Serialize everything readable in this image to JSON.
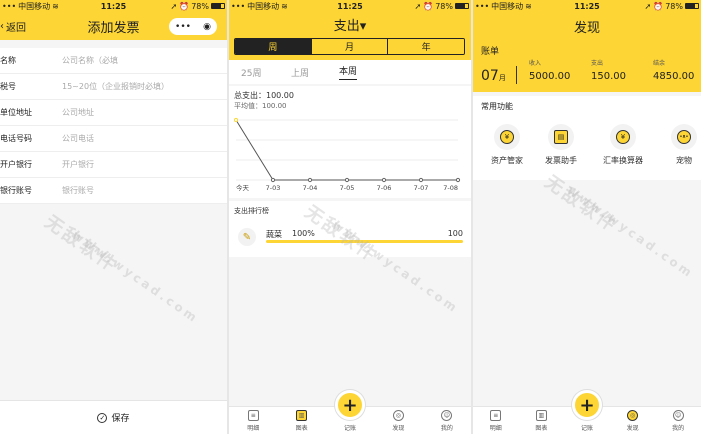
{
  "status": {
    "carrier": "中国移动",
    "time": "11:25",
    "battery": "78%",
    "battery_level": 0.78
  },
  "screen1": {
    "back_label": "返回",
    "title": "添加发票",
    "capsule_more": "•••",
    "capsule_close": "◉",
    "fields": [
      {
        "label": "名称",
        "placeholder": "公司名称（必填"
      },
      {
        "label": "税号",
        "placeholder": "15~20位（企业报销时必填）"
      },
      {
        "label": "单位地址",
        "placeholder": "公司地址"
      },
      {
        "label": "电话号码",
        "placeholder": "公司电话"
      },
      {
        "label": "开户银行",
        "placeholder": "开户银行"
      },
      {
        "label": "银行账号",
        "placeholder": "银行账号"
      }
    ],
    "save_label": "保存"
  },
  "screen2": {
    "title": "支出▾",
    "segments": [
      "周",
      "月",
      "年"
    ],
    "active_segment": 0,
    "weeks": [
      "25周",
      "上周",
      "本周"
    ],
    "total_label": "总支出：100.00",
    "avg_label": "平均值：100.00",
    "rank_title": "支出排行榜",
    "rank_items": [
      {
        "name": "蔬菜",
        "percent": "100%",
        "value": "100",
        "share": 1.0
      }
    ]
  },
  "chart_data": {
    "type": "line",
    "categories": [
      "今天",
      "7-03",
      "7-04",
      "7-05",
      "7-06",
      "7-07",
      "7-08"
    ],
    "values": [
      100,
      0,
      0,
      0,
      0,
      0,
      0
    ],
    "ylim": [
      0,
      100
    ]
  },
  "tabbar": {
    "items": [
      {
        "label": "明细",
        "icon": "list-icon"
      },
      {
        "label": "图表",
        "icon": "chart-icon"
      },
      {
        "label": "记账",
        "icon": "plus-icon"
      },
      {
        "label": "发现",
        "icon": "compass-icon"
      },
      {
        "label": "我的",
        "icon": "user-icon"
      }
    ],
    "fab_symbol": "+"
  },
  "screen3": {
    "title": "发现",
    "bill_title": "账单",
    "month": "07",
    "month_unit": "月",
    "income_label": "收入",
    "income_value": "5000.00",
    "expense_label": "支出",
    "expense_value": "150.00",
    "balance_label": "结余",
    "balance_value": "4850.00",
    "func_title": "常用功能",
    "functions": [
      {
        "label": "资产管家",
        "glyph": "¥"
      },
      {
        "label": "发票助手",
        "glyph": "▤"
      },
      {
        "label": "汇率换算器",
        "glyph": "¥"
      },
      {
        "label": "宠物",
        "glyph": "•ᴥ•"
      }
    ]
  },
  "watermark": {
    "text1": "无敌软件",
    "text2": "www.wycad.com"
  }
}
